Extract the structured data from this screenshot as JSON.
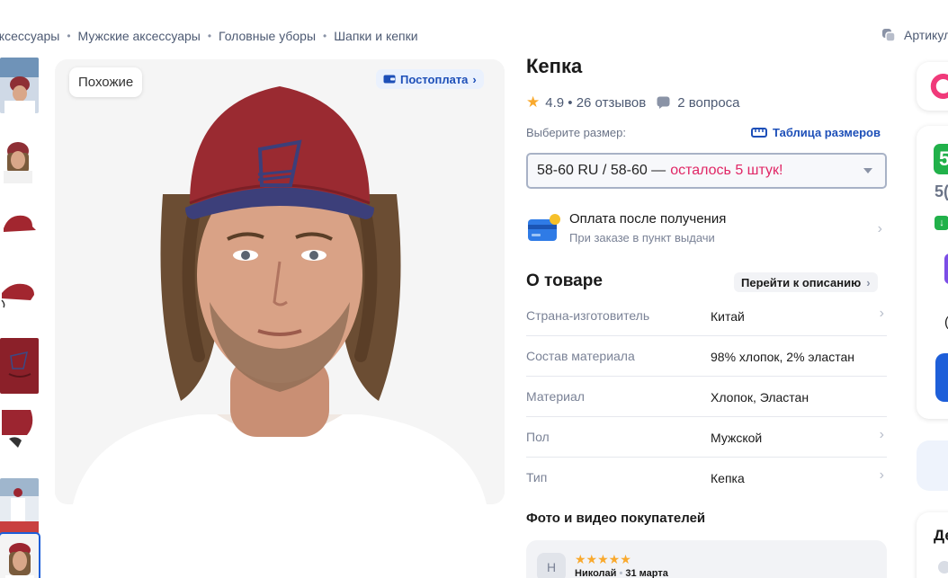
{
  "breadcrumb": {
    "items": [
      "аксессуары",
      "Мужские аксессуары",
      "Головные уборы",
      "Шапки и кепки"
    ]
  },
  "articul_label": "Артикул",
  "gallery": {
    "similar_label": "Похожие",
    "postpay_label": "Постоплата",
    "thumbnails": [
      "thumb-1",
      "thumb-2",
      "thumb-3",
      "thumb-4",
      "thumb-5",
      "thumb-6",
      "thumb-7",
      "thumb-8"
    ],
    "active_thumbnail": 8
  },
  "product": {
    "title": "Кепка",
    "rating": "4.9",
    "reviews": "26 отзывов",
    "questions": "2 вопроса",
    "size_label": "Выберите размер:",
    "size_table_link": "Таблица размеров",
    "selected_size": "58-60 RU / 58-60 —",
    "stock_left": "осталось 5 штук!",
    "payment_title": "Оплата после получения",
    "payment_subtitle": "При заказе в пункт выдачи",
    "about_heading": "О товаре",
    "goto_description": "Перейти к описанию",
    "specs": [
      {
        "key": "Страна-изготовитель",
        "value": "Китай",
        "link": true
      },
      {
        "key": "Состав материала",
        "value": "98% хлопок, 2% эластан",
        "link": false
      },
      {
        "key": "Материал",
        "value": "Хлопок, Эластан",
        "link": false
      },
      {
        "key": "Пол",
        "value": "Мужской",
        "link": true
      },
      {
        "key": "Тип",
        "value": "Кепка",
        "link": true
      }
    ],
    "customer_photos_heading": "Фото и видео покупателей",
    "review": {
      "avatar_letter": "Н",
      "stars": "★★★★★",
      "author": "Николай",
      "date": "31 марта"
    }
  },
  "sidebar": {
    "price_glyph": "5",
    "price_partial": "5(",
    "section_partial": "Де",
    "ring_partial": "("
  },
  "colors": {
    "accent_blue": "#1e5fd9",
    "stock_pink": "#e02665",
    "star_orange": "#f9a92d",
    "price_green": "#21b14a"
  }
}
